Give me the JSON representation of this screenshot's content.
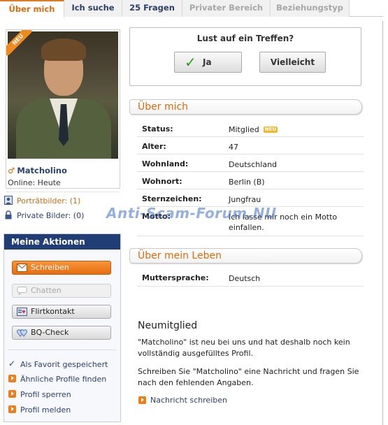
{
  "tabs": [
    {
      "label": "Über mich",
      "state": "active"
    },
    {
      "label": "Ich suche",
      "state": "normal"
    },
    {
      "label": "25 Fragen",
      "state": "normal"
    },
    {
      "label": "Privater Bereich",
      "state": "disabled"
    },
    {
      "label": "Beziehungstyp",
      "state": "disabled"
    }
  ],
  "profile": {
    "badge": "NEU",
    "username": "Matcholino",
    "online": "Online: Heute",
    "portrait_pics": "Porträtbilder: (1)",
    "private_pics": "Private Bilder: (0)"
  },
  "actions": {
    "title": "Meine Aktionen",
    "buttons": [
      "Schreiben",
      "Chatten",
      "Flirtkontakt",
      "BQ-Check"
    ],
    "links": [
      "Als Favorit gespeichert",
      "Ähnliche Profile finden",
      "Profil sperren",
      "Profil melden"
    ]
  },
  "meeting": {
    "question": "Lust auf ein Treffen?",
    "yes": "Ja",
    "maybe": "Vielleicht"
  },
  "about": {
    "title": "Über mich",
    "rows": [
      {
        "label": "Status:",
        "value": "Mitglied",
        "badge": "NEU"
      },
      {
        "label": "Alter:",
        "value": "47"
      },
      {
        "label": "Wohnland:",
        "value": "Deutschland"
      },
      {
        "label": "Wohnort:",
        "value": "Berlin (B)"
      },
      {
        "label": "Sternzeichen:",
        "value": "Jungfrau"
      },
      {
        "label": "Motto:",
        "value": "Ich lasse mir noch ein Motto einfallen."
      }
    ]
  },
  "life": {
    "title": "Über mein Leben",
    "rows": [
      {
        "label": "Muttersprache:",
        "value": "Deutsch"
      }
    ]
  },
  "new_member": {
    "title": "Neumitglied",
    "text1": "\"Matcholino\" ist neu bei uns und hat deshalb noch kein vollständig ausgefülltes Profil.",
    "text2": "Schreiben Sie \"Matcholino\" eine Nachricht und fragen Sie nach den fehlenden Angaben.",
    "link": "Nachricht schreiben"
  },
  "watermark": "Anti-Scam-Forum.NU",
  "colors": {
    "accent_orange": "#e06a0a",
    "nav_blue": "#213d75",
    "link_blue": "#2d3f73"
  }
}
